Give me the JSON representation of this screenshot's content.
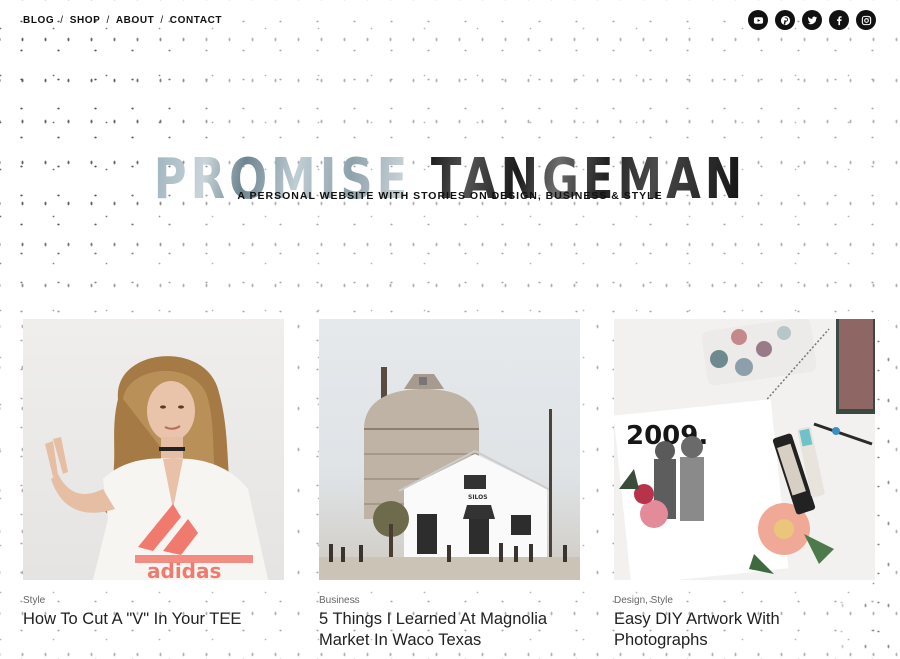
{
  "nav": {
    "items": [
      "BLOG",
      "SHOP",
      "ABOUT",
      "CONTACT"
    ],
    "separator": "/"
  },
  "social": [
    "youtube-icon",
    "pinterest-icon",
    "twitter-icon",
    "facebook-icon",
    "instagram-icon"
  ],
  "header": {
    "title_part1": "PROMISE",
    "title_part2": "TANGEMAN",
    "tagline": "A PERSONAL WEBSITE WITH STORIES ON DESIGN, BUSINESS & STYLE"
  },
  "posts": [
    {
      "category": "Style",
      "title": "How To Cut A \"V\" In Your TEE",
      "image_text": "adidas"
    },
    {
      "category": "Business",
      "title": "5 Things I Learned At Magnolia Market In Waco Texas",
      "image_text": "SILOS"
    },
    {
      "category": "Design, Style",
      "title": "Easy DIY Artwork With Photographs",
      "image_text": "2009."
    }
  ],
  "colors": {
    "text": "#222222",
    "nav": "#111111",
    "muted": "#666666",
    "accent": "#f07a6e"
  }
}
